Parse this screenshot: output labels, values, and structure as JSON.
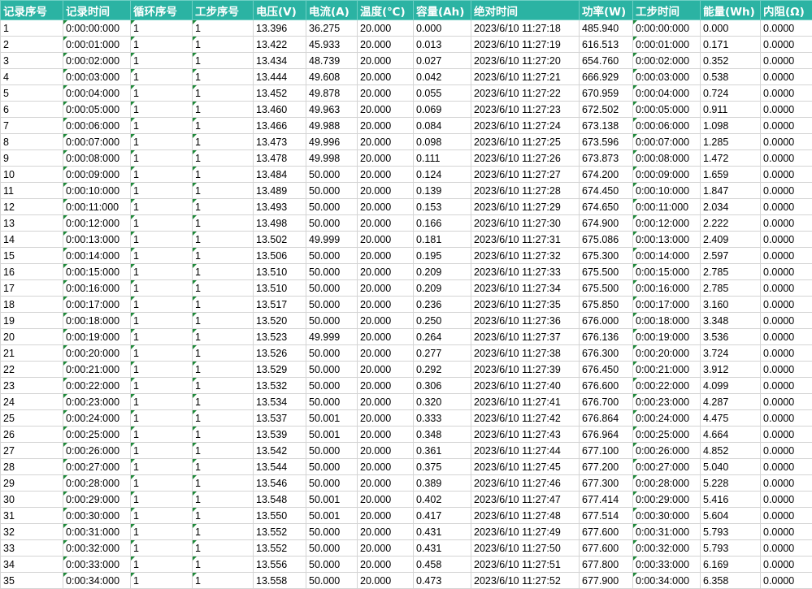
{
  "headers": [
    "记录序号",
    "记录时间",
    "循环序号",
    "工步序号",
    "电压(V)",
    "电流(A)",
    "温度(℃)",
    "容量(Ah)",
    "绝对时间",
    "功率(W)",
    "工步时间",
    "能量(Wh)",
    "内阻(Ω)"
  ],
  "rows": [
    [
      "1",
      "0:00:00:000",
      "1",
      "1",
      "13.396",
      "36.275",
      "20.000",
      "0.000",
      "2023/6/10 11:27:18",
      "485.940",
      "0:00:00:000",
      "0.000",
      "0.0000"
    ],
    [
      "2",
      "0:00:01:000",
      "1",
      "1",
      "13.422",
      "45.933",
      "20.000",
      "0.013",
      "2023/6/10 11:27:19",
      "616.513",
      "0:00:01:000",
      "0.171",
      "0.0000"
    ],
    [
      "3",
      "0:00:02:000",
      "1",
      "1",
      "13.434",
      "48.739",
      "20.000",
      "0.027",
      "2023/6/10 11:27:20",
      "654.760",
      "0:00:02:000",
      "0.352",
      "0.0000"
    ],
    [
      "4",
      "0:00:03:000",
      "1",
      "1",
      "13.444",
      "49.608",
      "20.000",
      "0.042",
      "2023/6/10 11:27:21",
      "666.929",
      "0:00:03:000",
      "0.538",
      "0.0000"
    ],
    [
      "5",
      "0:00:04:000",
      "1",
      "1",
      "13.452",
      "49.878",
      "20.000",
      "0.055",
      "2023/6/10 11:27:22",
      "670.959",
      "0:00:04:000",
      "0.724",
      "0.0000"
    ],
    [
      "6",
      "0:00:05:000",
      "1",
      "1",
      "13.460",
      "49.963",
      "20.000",
      "0.069",
      "2023/6/10 11:27:23",
      "672.502",
      "0:00:05:000",
      "0.911",
      "0.0000"
    ],
    [
      "7",
      "0:00:06:000",
      "1",
      "1",
      "13.466",
      "49.988",
      "20.000",
      "0.084",
      "2023/6/10 11:27:24",
      "673.138",
      "0:00:06:000",
      "1.098",
      "0.0000"
    ],
    [
      "8",
      "0:00:07:000",
      "1",
      "1",
      "13.473",
      "49.996",
      "20.000",
      "0.098",
      "2023/6/10 11:27:25",
      "673.596",
      "0:00:07:000",
      "1.285",
      "0.0000"
    ],
    [
      "9",
      "0:00:08:000",
      "1",
      "1",
      "13.478",
      "49.998",
      "20.000",
      "0.111",
      "2023/6/10 11:27:26",
      "673.873",
      "0:00:08:000",
      "1.472",
      "0.0000"
    ],
    [
      "10",
      "0:00:09:000",
      "1",
      "1",
      "13.484",
      "50.000",
      "20.000",
      "0.124",
      "2023/6/10 11:27:27",
      "674.200",
      "0:00:09:000",
      "1.659",
      "0.0000"
    ],
    [
      "11",
      "0:00:10:000",
      "1",
      "1",
      "13.489",
      "50.000",
      "20.000",
      "0.139",
      "2023/6/10 11:27:28",
      "674.450",
      "0:00:10:000",
      "1.847",
      "0.0000"
    ],
    [
      "12",
      "0:00:11:000",
      "1",
      "1",
      "13.493",
      "50.000",
      "20.000",
      "0.153",
      "2023/6/10 11:27:29",
      "674.650",
      "0:00:11:000",
      "2.034",
      "0.0000"
    ],
    [
      "13",
      "0:00:12:000",
      "1",
      "1",
      "13.498",
      "50.000",
      "20.000",
      "0.166",
      "2023/6/10 11:27:30",
      "674.900",
      "0:00:12:000",
      "2.222",
      "0.0000"
    ],
    [
      "14",
      "0:00:13:000",
      "1",
      "1",
      "13.502",
      "49.999",
      "20.000",
      "0.181",
      "2023/6/10 11:27:31",
      "675.086",
      "0:00:13:000",
      "2.409",
      "0.0000"
    ],
    [
      "15",
      "0:00:14:000",
      "1",
      "1",
      "13.506",
      "50.000",
      "20.000",
      "0.195",
      "2023/6/10 11:27:32",
      "675.300",
      "0:00:14:000",
      "2.597",
      "0.0000"
    ],
    [
      "16",
      "0:00:15:000",
      "1",
      "1",
      "13.510",
      "50.000",
      "20.000",
      "0.209",
      "2023/6/10 11:27:33",
      "675.500",
      "0:00:15:000",
      "2.785",
      "0.0000"
    ],
    [
      "17",
      "0:00:16:000",
      "1",
      "1",
      "13.510",
      "50.000",
      "20.000",
      "0.209",
      "2023/6/10 11:27:34",
      "675.500",
      "0:00:16:000",
      "2.785",
      "0.0000"
    ],
    [
      "18",
      "0:00:17:000",
      "1",
      "1",
      "13.517",
      "50.000",
      "20.000",
      "0.236",
      "2023/6/10 11:27:35",
      "675.850",
      "0:00:17:000",
      "3.160",
      "0.0000"
    ],
    [
      "19",
      "0:00:18:000",
      "1",
      "1",
      "13.520",
      "50.000",
      "20.000",
      "0.250",
      "2023/6/10 11:27:36",
      "676.000",
      "0:00:18:000",
      "3.348",
      "0.0000"
    ],
    [
      "20",
      "0:00:19:000",
      "1",
      "1",
      "13.523",
      "49.999",
      "20.000",
      "0.264",
      "2023/6/10 11:27:37",
      "676.136",
      "0:00:19:000",
      "3.536",
      "0.0000"
    ],
    [
      "21",
      "0:00:20:000",
      "1",
      "1",
      "13.526",
      "50.000",
      "20.000",
      "0.277",
      "2023/6/10 11:27:38",
      "676.300",
      "0:00:20:000",
      "3.724",
      "0.0000"
    ],
    [
      "22",
      "0:00:21:000",
      "1",
      "1",
      "13.529",
      "50.000",
      "20.000",
      "0.292",
      "2023/6/10 11:27:39",
      "676.450",
      "0:00:21:000",
      "3.912",
      "0.0000"
    ],
    [
      "23",
      "0:00:22:000",
      "1",
      "1",
      "13.532",
      "50.000",
      "20.000",
      "0.306",
      "2023/6/10 11:27:40",
      "676.600",
      "0:00:22:000",
      "4.099",
      "0.0000"
    ],
    [
      "24",
      "0:00:23:000",
      "1",
      "1",
      "13.534",
      "50.000",
      "20.000",
      "0.320",
      "2023/6/10 11:27:41",
      "676.700",
      "0:00:23:000",
      "4.287",
      "0.0000"
    ],
    [
      "25",
      "0:00:24:000",
      "1",
      "1",
      "13.537",
      "50.001",
      "20.000",
      "0.333",
      "2023/6/10 11:27:42",
      "676.864",
      "0:00:24:000",
      "4.475",
      "0.0000"
    ],
    [
      "26",
      "0:00:25:000",
      "1",
      "1",
      "13.539",
      "50.001",
      "20.000",
      "0.348",
      "2023/6/10 11:27:43",
      "676.964",
      "0:00:25:000",
      "4.664",
      "0.0000"
    ],
    [
      "27",
      "0:00:26:000",
      "1",
      "1",
      "13.542",
      "50.000",
      "20.000",
      "0.361",
      "2023/6/10 11:27:44",
      "677.100",
      "0:00:26:000",
      "4.852",
      "0.0000"
    ],
    [
      "28",
      "0:00:27:000",
      "1",
      "1",
      "13.544",
      "50.000",
      "20.000",
      "0.375",
      "2023/6/10 11:27:45",
      "677.200",
      "0:00:27:000",
      "5.040",
      "0.0000"
    ],
    [
      "29",
      "0:00:28:000",
      "1",
      "1",
      "13.546",
      "50.000",
      "20.000",
      "0.389",
      "2023/6/10 11:27:46",
      "677.300",
      "0:00:28:000",
      "5.228",
      "0.0000"
    ],
    [
      "30",
      "0:00:29:000",
      "1",
      "1",
      "13.548",
      "50.001",
      "20.000",
      "0.402",
      "2023/6/10 11:27:47",
      "677.414",
      "0:00:29:000",
      "5.416",
      "0.0000"
    ],
    [
      "31",
      "0:00:30:000",
      "1",
      "1",
      "13.550",
      "50.001",
      "20.000",
      "0.417",
      "2023/6/10 11:27:48",
      "677.514",
      "0:00:30:000",
      "5.604",
      "0.0000"
    ],
    [
      "32",
      "0:00:31:000",
      "1",
      "1",
      "13.552",
      "50.000",
      "20.000",
      "0.431",
      "2023/6/10 11:27:49",
      "677.600",
      "0:00:31:000",
      "5.793",
      "0.0000"
    ],
    [
      "33",
      "0:00:32:000",
      "1",
      "1",
      "13.552",
      "50.000",
      "20.000",
      "0.431",
      "2023/6/10 11:27:50",
      "677.600",
      "0:00:32:000",
      "5.793",
      "0.0000"
    ],
    [
      "34",
      "0:00:33:000",
      "1",
      "1",
      "13.556",
      "50.000",
      "20.000",
      "0.458",
      "2023/6/10 11:27:51",
      "677.800",
      "0:00:33:000",
      "6.169",
      "0.0000"
    ],
    [
      "35",
      "0:00:34:000",
      "1",
      "1",
      "13.558",
      "50.000",
      "20.000",
      "0.473",
      "2023/6/10 11:27:52",
      "677.900",
      "0:00:34:000",
      "6.358",
      "0.0000"
    ]
  ],
  "colors": {
    "header_bg": "#2bb3a3",
    "header_text": "#ffffff",
    "grid": "#d4d4d4",
    "text_marker": "#1f8a3a"
  }
}
